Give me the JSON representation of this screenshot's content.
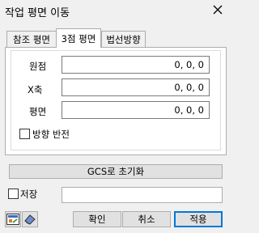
{
  "window": {
    "title": "작업 평면 이동",
    "close_icon": "close-icon"
  },
  "tabs": [
    {
      "label": "참조 평면",
      "active": false
    },
    {
      "label": "3점 평면",
      "active": true
    },
    {
      "label": "법선방향",
      "active": false
    }
  ],
  "fields": {
    "origin": {
      "label": "원점",
      "value": "0, 0, 0"
    },
    "x_axis": {
      "label": "X축",
      "value": "0, 0, 0"
    },
    "plane": {
      "label": "평면",
      "value": "0, 0, 0"
    }
  },
  "reverse_direction": {
    "label": "방향 반전",
    "checked": false
  },
  "reset_button": "GCS로 초기화",
  "save": {
    "label": "저장",
    "checked": false,
    "value": ""
  },
  "buttons": {
    "ok": "확인",
    "cancel": "취소",
    "apply": "적용"
  },
  "icons": {
    "left": "ucs-icon",
    "right": "eraser-icon"
  }
}
